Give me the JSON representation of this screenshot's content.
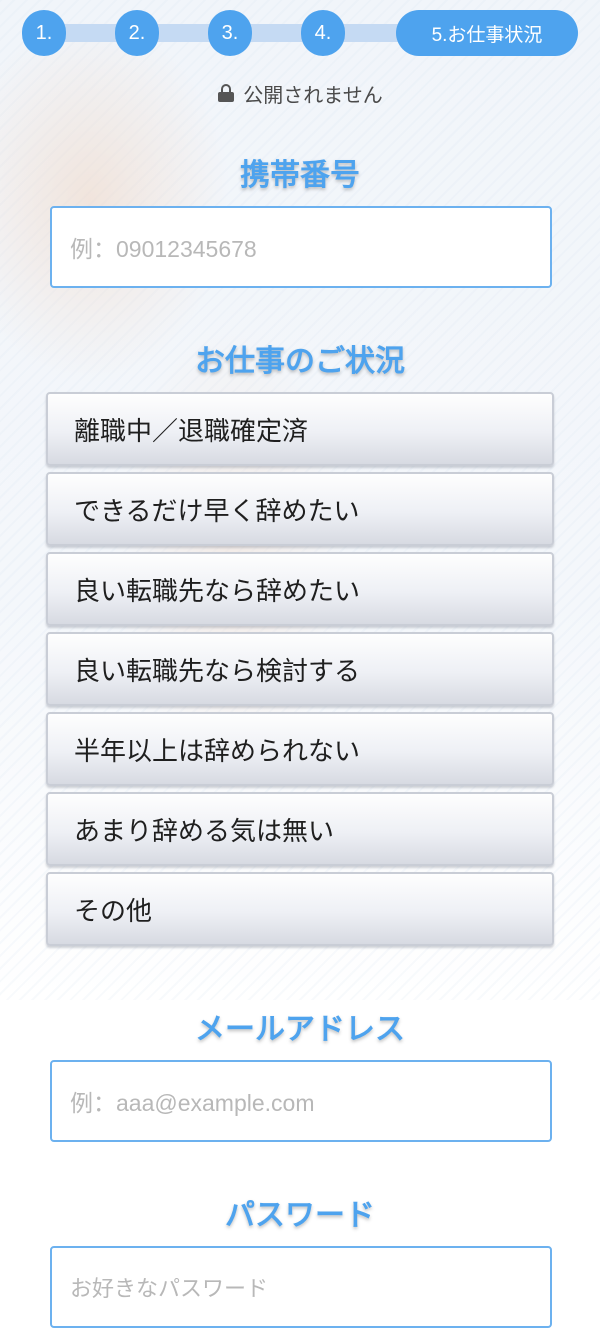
{
  "steps": [
    "1.",
    "2.",
    "3.",
    "4.",
    "5.お仕事状況"
  ],
  "privacy_note": "公開されません",
  "phone": {
    "heading": "携帯番号",
    "placeholder": "例：09012345678"
  },
  "job_status": {
    "heading": "お仕事のご状況",
    "options": [
      "離職中／退職確定済",
      "できるだけ早く辞めたい",
      "良い転職先なら辞めたい",
      "良い転職先なら検討する",
      "半年以上は辞められない",
      "あまり辞める気は無い",
      "その他"
    ]
  },
  "email": {
    "heading": "メールアドレス",
    "placeholder": "例：aaa@example.com"
  },
  "password": {
    "heading": "パスワード",
    "placeholder": "お好きなパスワード"
  },
  "colors": {
    "accent": "#4ea3ee",
    "track": "#c5daf3",
    "field_border": "#6cb1ef"
  }
}
